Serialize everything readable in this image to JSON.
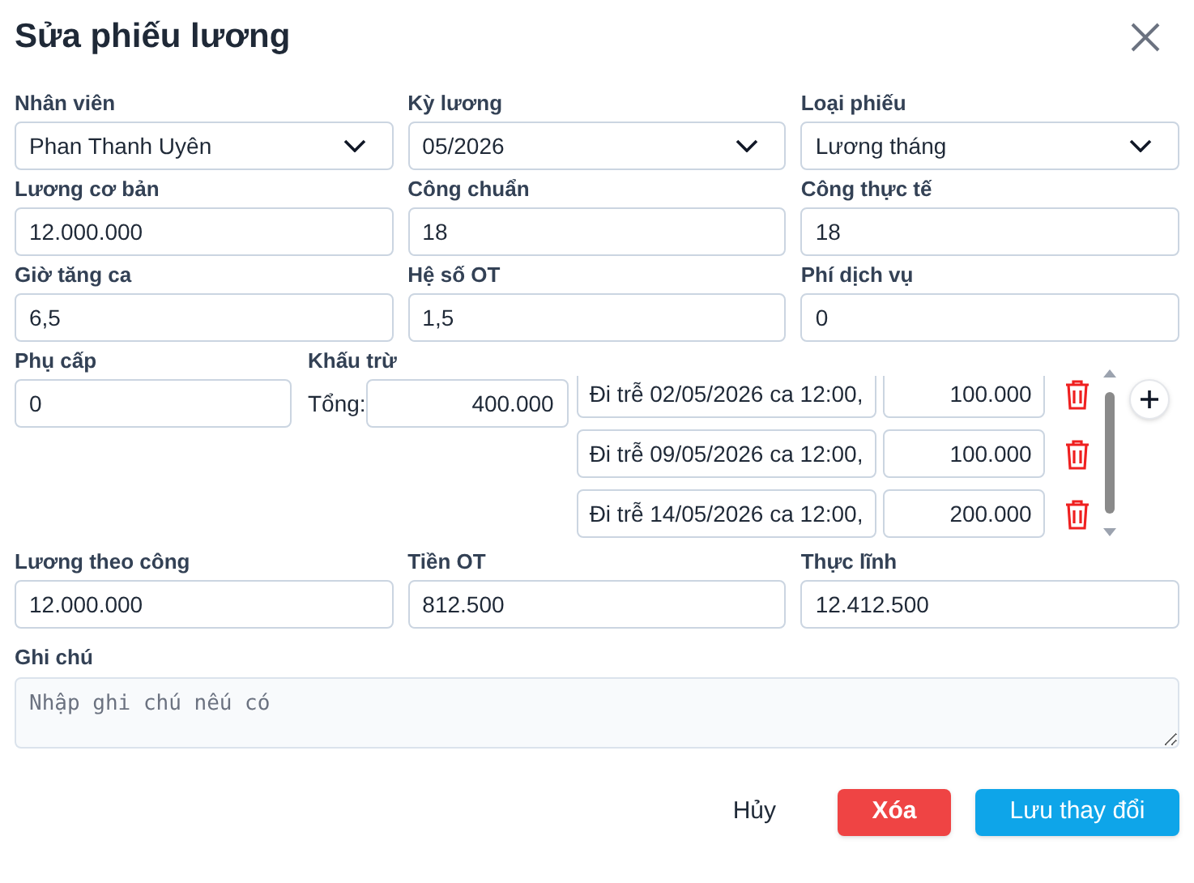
{
  "title": "Sửa phiếu lương",
  "rows": [
    [
      {
        "label": "Nhân viên",
        "value": "Phan Thanh Uyên",
        "kind": "select"
      },
      {
        "label": "Kỳ lương",
        "value": "05/2026",
        "kind": "select"
      },
      {
        "label": "Loại phiếu",
        "value": "Lương tháng",
        "kind": "select"
      }
    ],
    [
      {
        "label": "Lương cơ bản",
        "value": "12.000.000",
        "kind": "input"
      },
      {
        "label": "Công chuẩn",
        "value": "18",
        "kind": "input"
      },
      {
        "label": "Công thực tế",
        "value": "18",
        "kind": "input"
      }
    ],
    [
      {
        "label": "Giờ tăng ca",
        "value": "6,5",
        "kind": "input"
      },
      {
        "label": "Hệ số OT",
        "value": "1,5",
        "kind": "input"
      },
      {
        "label": "Phí dịch vụ",
        "value": "0",
        "kind": "input"
      }
    ]
  ],
  "allowance": {
    "label": "Phụ cấp",
    "value": "0"
  },
  "deductions": {
    "label": "Khấu trừ",
    "total_label": "Tổng:",
    "total": "400.000",
    "items": [
      {
        "reason": "Đi trễ 02/05/2026 ca 12:00,",
        "amount": "100.000"
      },
      {
        "reason": "Đi trễ 09/05/2026 ca 12:00,",
        "amount": "100.000"
      },
      {
        "reason": "Đi trễ 14/05/2026 ca 12:00,",
        "amount": "200.000"
      }
    ]
  },
  "totals": [
    {
      "label": "Lương theo công",
      "value": "12.000.000"
    },
    {
      "label": "Tiền OT",
      "value": "812.500"
    },
    {
      "label": "Thực lĩnh",
      "value": "12.412.500"
    }
  ],
  "note": {
    "label": "Ghi chú",
    "placeholder": "Nhập ghi chú nếu có"
  },
  "buttons": [
    {
      "label": "Hủy",
      "kind": "text"
    },
    {
      "label": "Xóa",
      "kind": "danger"
    },
    {
      "label": "Lưu thay đổi",
      "kind": "primary"
    }
  ]
}
